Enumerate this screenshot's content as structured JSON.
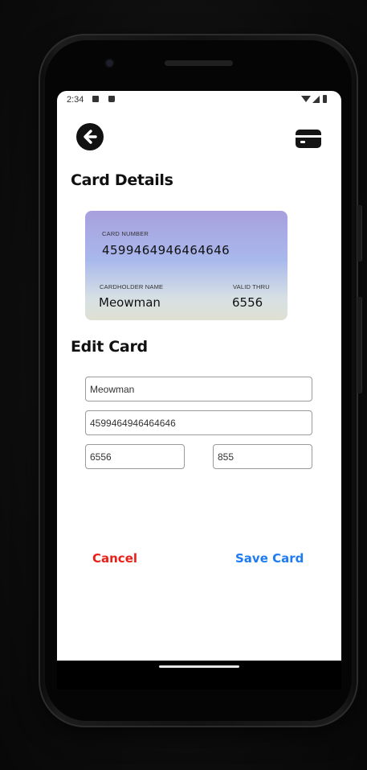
{
  "status_bar": {
    "time": "2:34"
  },
  "header": {
    "back_icon": "arrow-left-circle-icon",
    "card_icon": "credit-card-icon"
  },
  "card_details": {
    "title": "Card Details",
    "card": {
      "number_label": "CARD NUMBER",
      "number": "4599464946464646",
      "holder_label": "CARDHOLDER NAME",
      "holder": "Meowman",
      "valid_label": "VALID THRU",
      "valid": "6556"
    }
  },
  "edit_card": {
    "title": "Edit Card",
    "fields": {
      "name": "Meowman",
      "number": "4599464946464646",
      "valid": "6556",
      "cvv": "855"
    }
  },
  "actions": {
    "cancel": "Cancel",
    "save": "Save Card"
  },
  "colors": {
    "cancel": "#e8201a",
    "save": "#1e7bf0",
    "card_gradient_top": "#a8a0de",
    "card_gradient_bottom": "#dfe0d2"
  }
}
